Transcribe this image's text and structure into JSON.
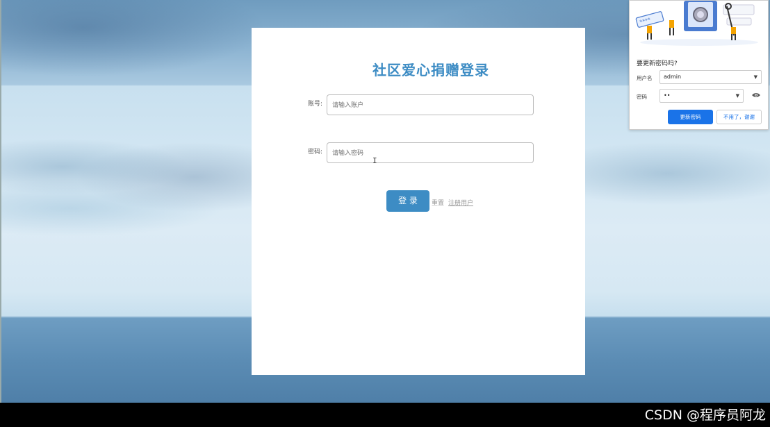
{
  "login": {
    "title": "社区爱心捐赠登录",
    "account_label": "账号:",
    "account_placeholder": "请输入账户",
    "password_label": "密码:",
    "password_placeholder": "请输入密码",
    "login_button": "登 录",
    "reset_link": "重置",
    "register_link": "注册用户"
  },
  "password_prompt": {
    "title": "要更新密码吗?",
    "username_label": "用户名",
    "username_value": "admin",
    "password_label": "密码",
    "password_value": "••",
    "update_button": "更新密码",
    "dismiss_button": "不用了，谢谢",
    "illustration_text": "****"
  },
  "watermark": "CSDN @程序员阿龙",
  "colors": {
    "accent": "#3d8cc4",
    "chrome_blue": "#1a73e8"
  },
  "icons": {
    "dropdown": "chevron-down-icon",
    "eye": "eye-icon"
  }
}
